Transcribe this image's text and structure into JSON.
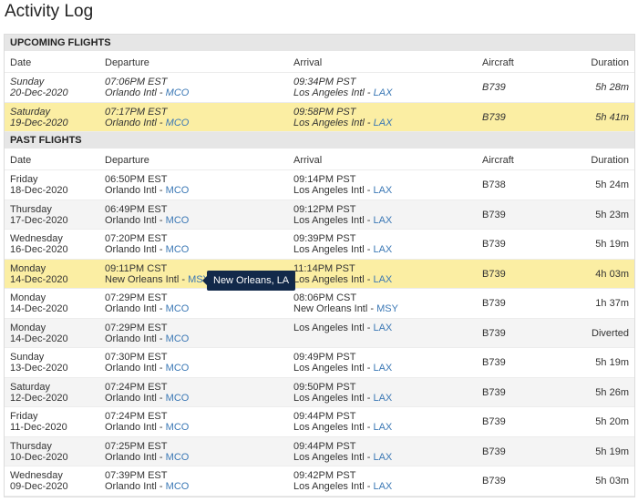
{
  "page": {
    "title": "Activity Log"
  },
  "columns": {
    "date": "Date",
    "departure": "Departure",
    "arrival": "Arrival",
    "aircraft": "Aircraft",
    "duration": "Duration"
  },
  "upcoming": {
    "title": "UPCOMING FLIGHTS",
    "rows": [
      {
        "day": "Sunday",
        "date": "20-Dec-2020",
        "dep_time": "07:06PM EST",
        "dep_airport": "Orlando Intl",
        "dep_code": "MCO",
        "arr_time": "09:34PM PST",
        "arr_airport": "Los Angeles Intl",
        "arr_code": "LAX",
        "aircraft": "B739",
        "duration": "5h 28m"
      },
      {
        "day": "Saturday",
        "date": "19-Dec-2020",
        "dep_time": "07:17PM EST",
        "dep_airport": "Orlando Intl",
        "dep_code": "MCO",
        "arr_time": "09:58PM PST",
        "arr_airport": "Los Angeles Intl",
        "arr_code": "LAX",
        "aircraft": "B739",
        "duration": "5h 41m"
      }
    ]
  },
  "past": {
    "title": "PAST FLIGHTS",
    "rows": [
      {
        "day": "Friday",
        "date": "18-Dec-2020",
        "dep_time": "06:50PM EST",
        "dep_airport": "Orlando Intl",
        "dep_code": "MCO",
        "arr_time": "09:14PM PST",
        "arr_airport": "Los Angeles Intl",
        "arr_code": "LAX",
        "aircraft": "B738",
        "duration": "5h 24m"
      },
      {
        "day": "Thursday",
        "date": "17-Dec-2020",
        "dep_time": "06:49PM EST",
        "dep_airport": "Orlando Intl",
        "dep_code": "MCO",
        "arr_time": "09:12PM PST",
        "arr_airport": "Los Angeles Intl",
        "arr_code": "LAX",
        "aircraft": "B739",
        "duration": "5h 23m"
      },
      {
        "day": "Wednesday",
        "date": "16-Dec-2020",
        "dep_time": "07:20PM EST",
        "dep_airport": "Orlando Intl",
        "dep_code": "MCO",
        "arr_time": "09:39PM PST",
        "arr_airport": "Los Angeles Intl",
        "arr_code": "LAX",
        "aircraft": "B739",
        "duration": "5h 19m"
      },
      {
        "day": "Monday",
        "date": "14-Dec-2020",
        "dep_time": "09:11PM CST",
        "dep_airport": "New Orleans Intl",
        "dep_code": "MSY",
        "arr_time": "11:14PM PST",
        "arr_airport": "Los Angeles Intl",
        "arr_code": "LAX",
        "aircraft": "B739",
        "duration": "4h 03m",
        "tooltip": "New Orleans, LA"
      },
      {
        "day": "Monday",
        "date": "14-Dec-2020",
        "dep_time": "07:29PM EST",
        "dep_airport": "Orlando Intl",
        "dep_code": "MCO",
        "arr_time": "08:06PM CST",
        "arr_airport": "New Orleans Intl",
        "arr_code": "MSY",
        "aircraft": "B739",
        "duration": "1h 37m"
      },
      {
        "day": "Monday",
        "date": "14-Dec-2020",
        "dep_time": "07:29PM EST",
        "dep_airport": "Orlando Intl",
        "dep_code": "MCO",
        "arr_time": "",
        "arr_airport": "Los Angeles Intl",
        "arr_code": "LAX",
        "aircraft": "B739",
        "duration": "Diverted"
      },
      {
        "day": "Sunday",
        "date": "13-Dec-2020",
        "dep_time": "07:30PM EST",
        "dep_airport": "Orlando Intl",
        "dep_code": "MCO",
        "arr_time": "09:49PM PST",
        "arr_airport": "Los Angeles Intl",
        "arr_code": "LAX",
        "aircraft": "B739",
        "duration": "5h 19m"
      },
      {
        "day": "Saturday",
        "date": "12-Dec-2020",
        "dep_time": "07:24PM EST",
        "dep_airport": "Orlando Intl",
        "dep_code": "MCO",
        "arr_time": "09:50PM PST",
        "arr_airport": "Los Angeles Intl",
        "arr_code": "LAX",
        "aircraft": "B739",
        "duration": "5h 26m"
      },
      {
        "day": "Friday",
        "date": "11-Dec-2020",
        "dep_time": "07:24PM EST",
        "dep_airport": "Orlando Intl",
        "dep_code": "MCO",
        "arr_time": "09:44PM PST",
        "arr_airport": "Los Angeles Intl",
        "arr_code": "LAX",
        "aircraft": "B739",
        "duration": "5h 20m"
      },
      {
        "day": "Thursday",
        "date": "10-Dec-2020",
        "dep_time": "07:25PM EST",
        "dep_airport": "Orlando Intl",
        "dep_code": "MCO",
        "arr_time": "09:44PM PST",
        "arr_airport": "Los Angeles Intl",
        "arr_code": "LAX",
        "aircraft": "B739",
        "duration": "5h 19m"
      },
      {
        "day": "Wednesday",
        "date": "09-Dec-2020",
        "dep_time": "07:39PM EST",
        "dep_airport": "Orlando Intl",
        "dep_code": "MCO",
        "arr_time": "09:42PM PST",
        "arr_airport": "Los Angeles Intl",
        "arr_code": "LAX",
        "aircraft": "B739",
        "duration": "5h 03m"
      }
    ]
  },
  "colors": {
    "link": "#3b78b5",
    "highlight": "#fbeea3",
    "header_bg": "#e6e6e6",
    "tooltip_bg": "#12294a"
  }
}
